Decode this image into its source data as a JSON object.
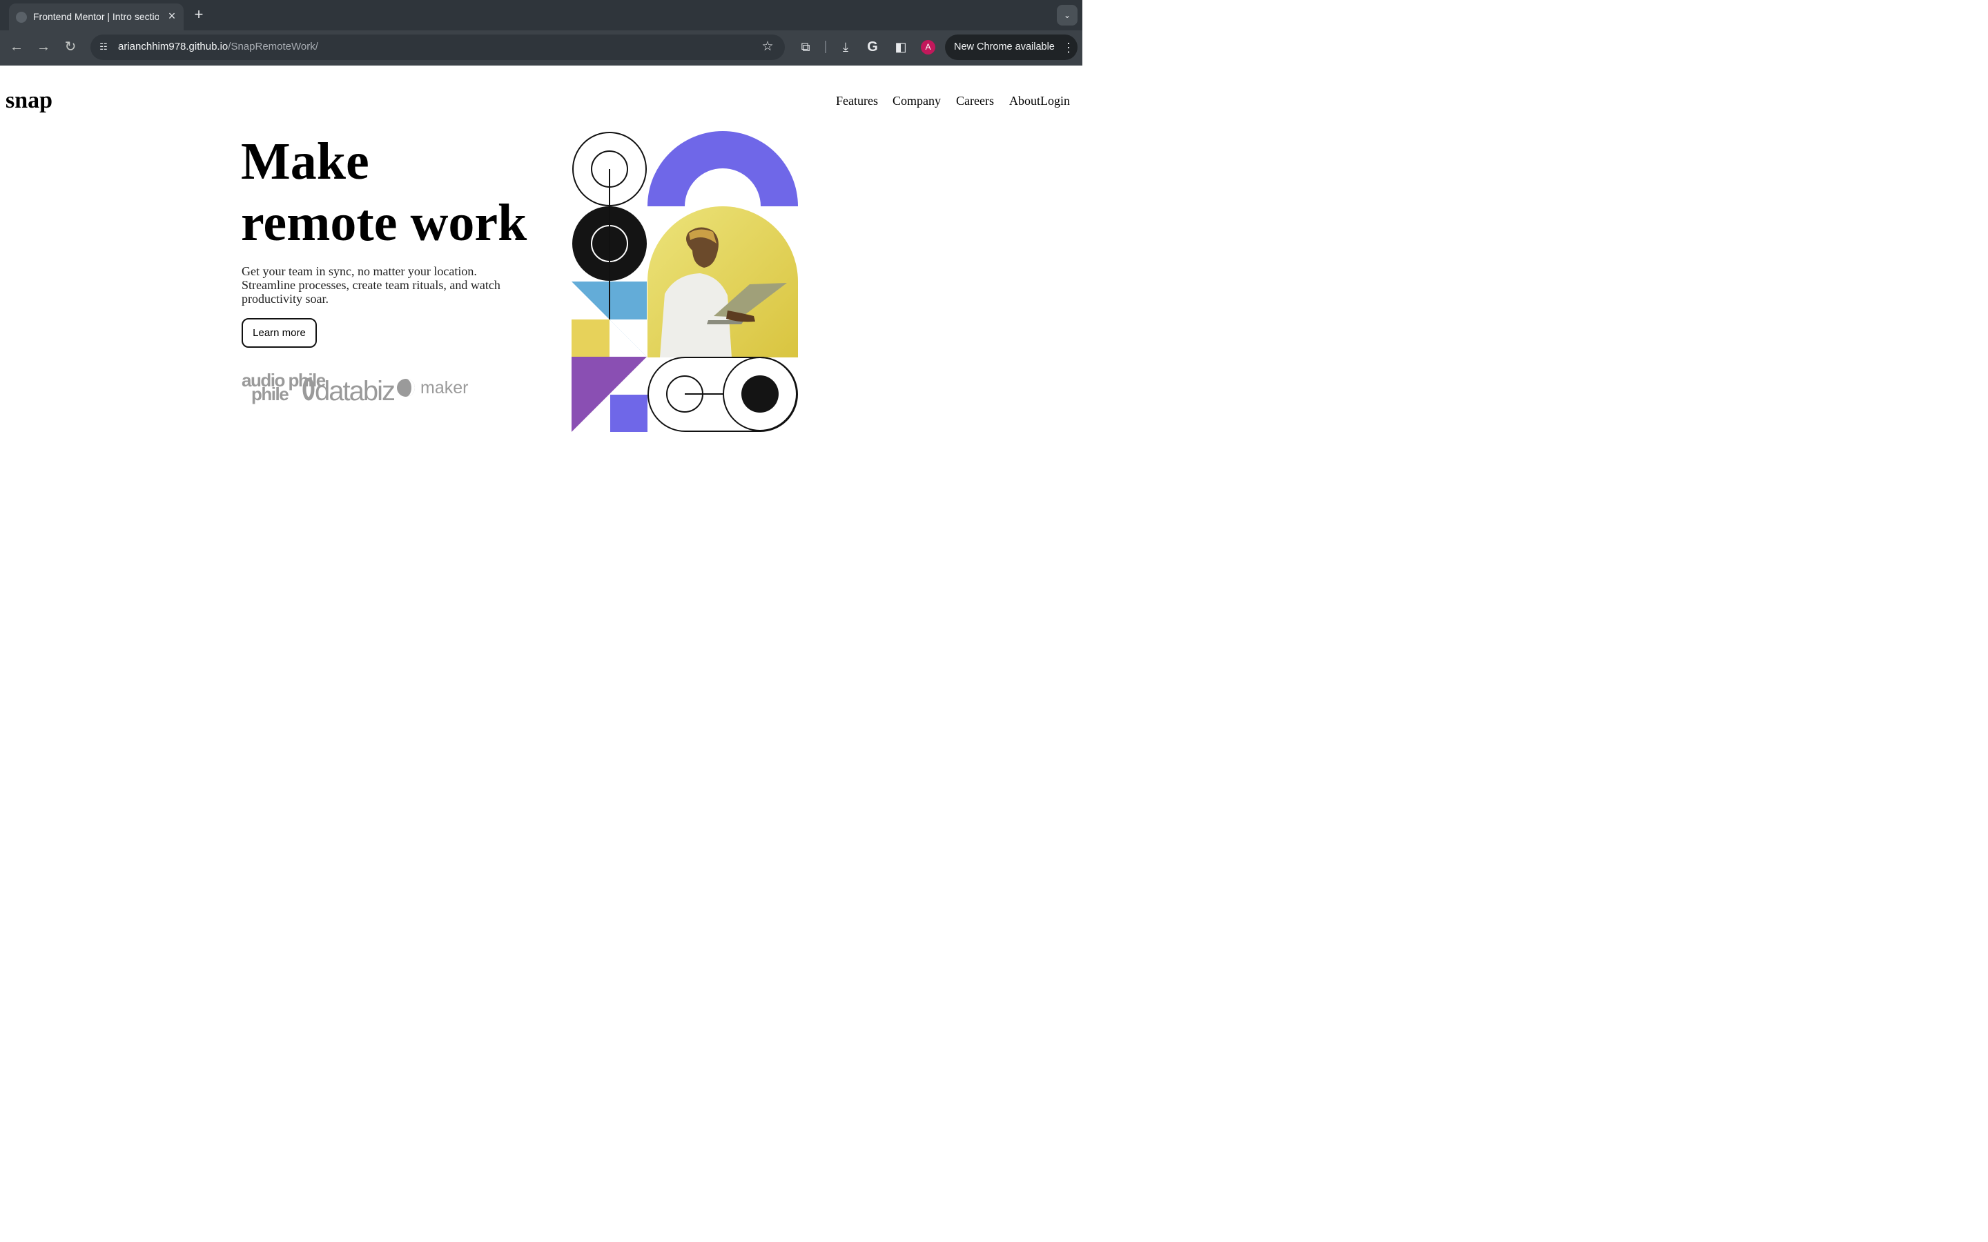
{
  "browser": {
    "tab_title": "Frontend Mentor | Intro section with dropdown navigation",
    "tab_close_icon": "close-icon",
    "new_tab_icon": "plus-icon",
    "url_host": "arianchhim978.github.io",
    "url_path": "/SnapRemoteWork/",
    "avatar_letter": "A",
    "update_label": "New Chrome available",
    "accent_color": "#c2185b"
  },
  "page": {
    "logo": "snap",
    "nav": {
      "features": "Features",
      "company": "Company",
      "careers": "Careers",
      "about": "About",
      "login": "Login"
    },
    "hero": {
      "title_line1": "Make",
      "title_line2": "remote work",
      "description": "Get your team in sync, no matter your location. Streamline processes, create team rituals, and watch productivity soar.",
      "cta": "Learn more"
    },
    "clients": [
      "audio phile",
      "databiz",
      "maker"
    ],
    "colors": {
      "purple": "#6f67e8",
      "yellow": "#e7d25a",
      "blue": "#63acd8",
      "violet": "#8a4fb3",
      "black": "#141414"
    }
  }
}
